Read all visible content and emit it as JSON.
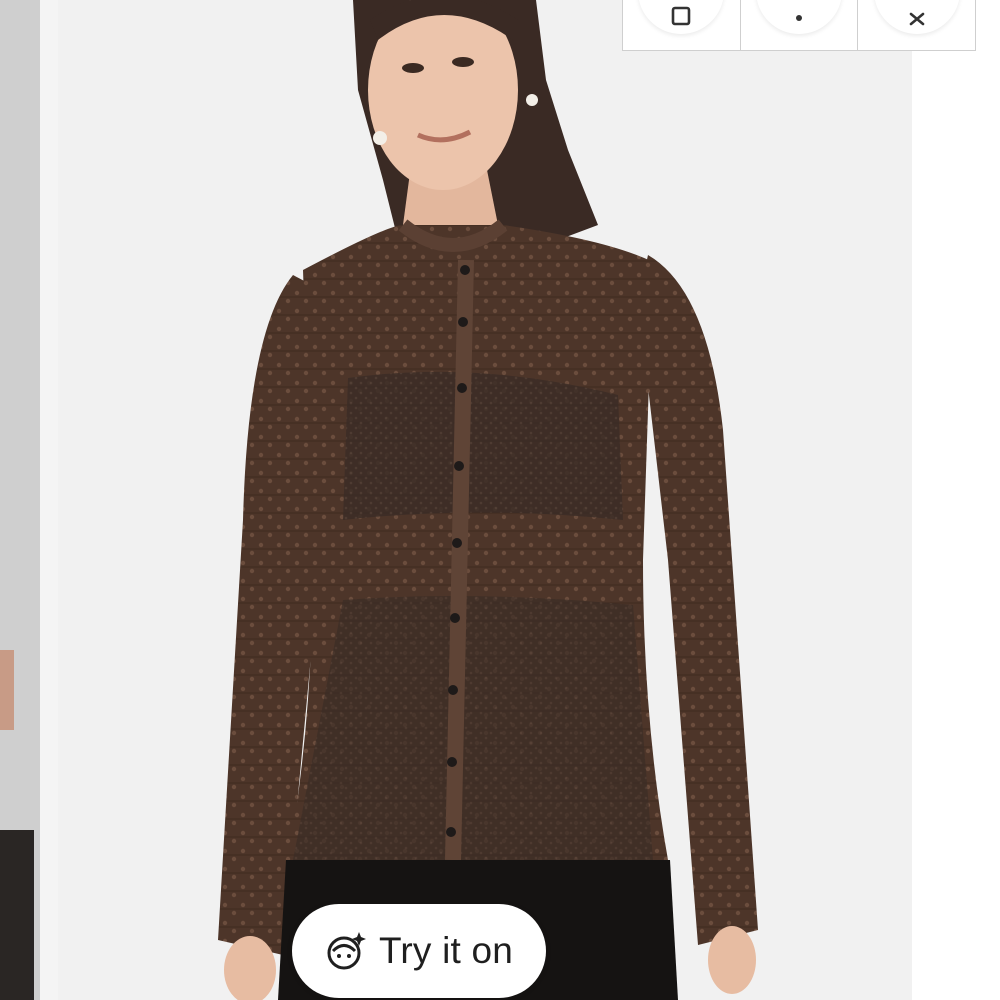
{
  "try_on": {
    "label": "Try it on",
    "icon": "face-sparkle-icon"
  },
  "actions": [
    {
      "name": "bag-icon"
    },
    {
      "name": "more-options-icon"
    },
    {
      "name": "close-icon"
    }
  ],
  "product_image": {
    "subject": "model-wearing-brown-knit-cardigan"
  },
  "colors": {
    "cardigan": "#4a3328",
    "background": "#f1f1f1",
    "pill": "#ffffff"
  }
}
